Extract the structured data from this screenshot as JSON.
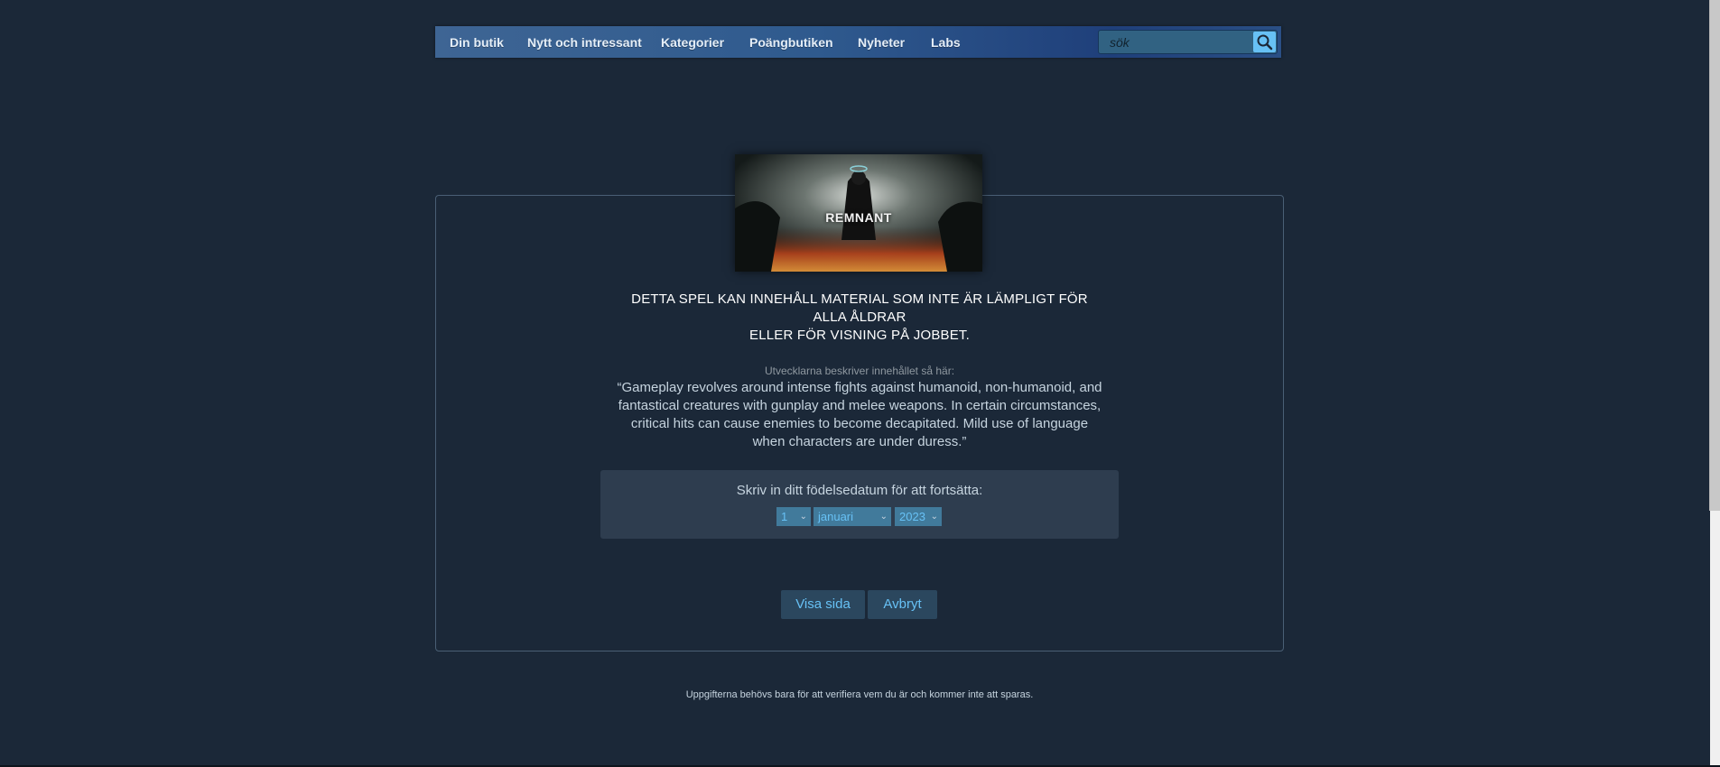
{
  "nav": {
    "items": [
      {
        "label": "Din butik"
      },
      {
        "label": "Nytt och intressant"
      },
      {
        "label": "Kategorier"
      },
      {
        "label": "Poängbutiken"
      },
      {
        "label": "Nyheter"
      },
      {
        "label": "Labs"
      }
    ],
    "search_placeholder": "sök"
  },
  "game": {
    "capsule_title": "REMNANT"
  },
  "warning": {
    "line1": "DETTA SPEL KAN INNEHÅLL MATERIAL SOM INTE ÄR LÄMPLIGT FÖR ALLA ÅLDRAR",
    "line2": "ELLER FÖR VISNING PÅ JOBBET."
  },
  "developer": {
    "label": "Utvecklarna beskriver innehållet så här:",
    "description": "“Gameplay revolves around intense fights against humanoid, non-humanoid, and fantastical creatures with gunplay and melee weapons. In certain circumstances, critical hits can cause enemies to become decapitated. Mild use of language when characters are under duress.”"
  },
  "age_gate": {
    "prompt": "Skriv in ditt födelsedatum för att fortsätta:",
    "day": "1",
    "month": "januari",
    "year": "2023"
  },
  "buttons": {
    "view": "Visa sida",
    "cancel": "Avbryt"
  },
  "footer": "Uppgifterna behövs bara för att verifiera vem du är och kommer inte att sparas."
}
